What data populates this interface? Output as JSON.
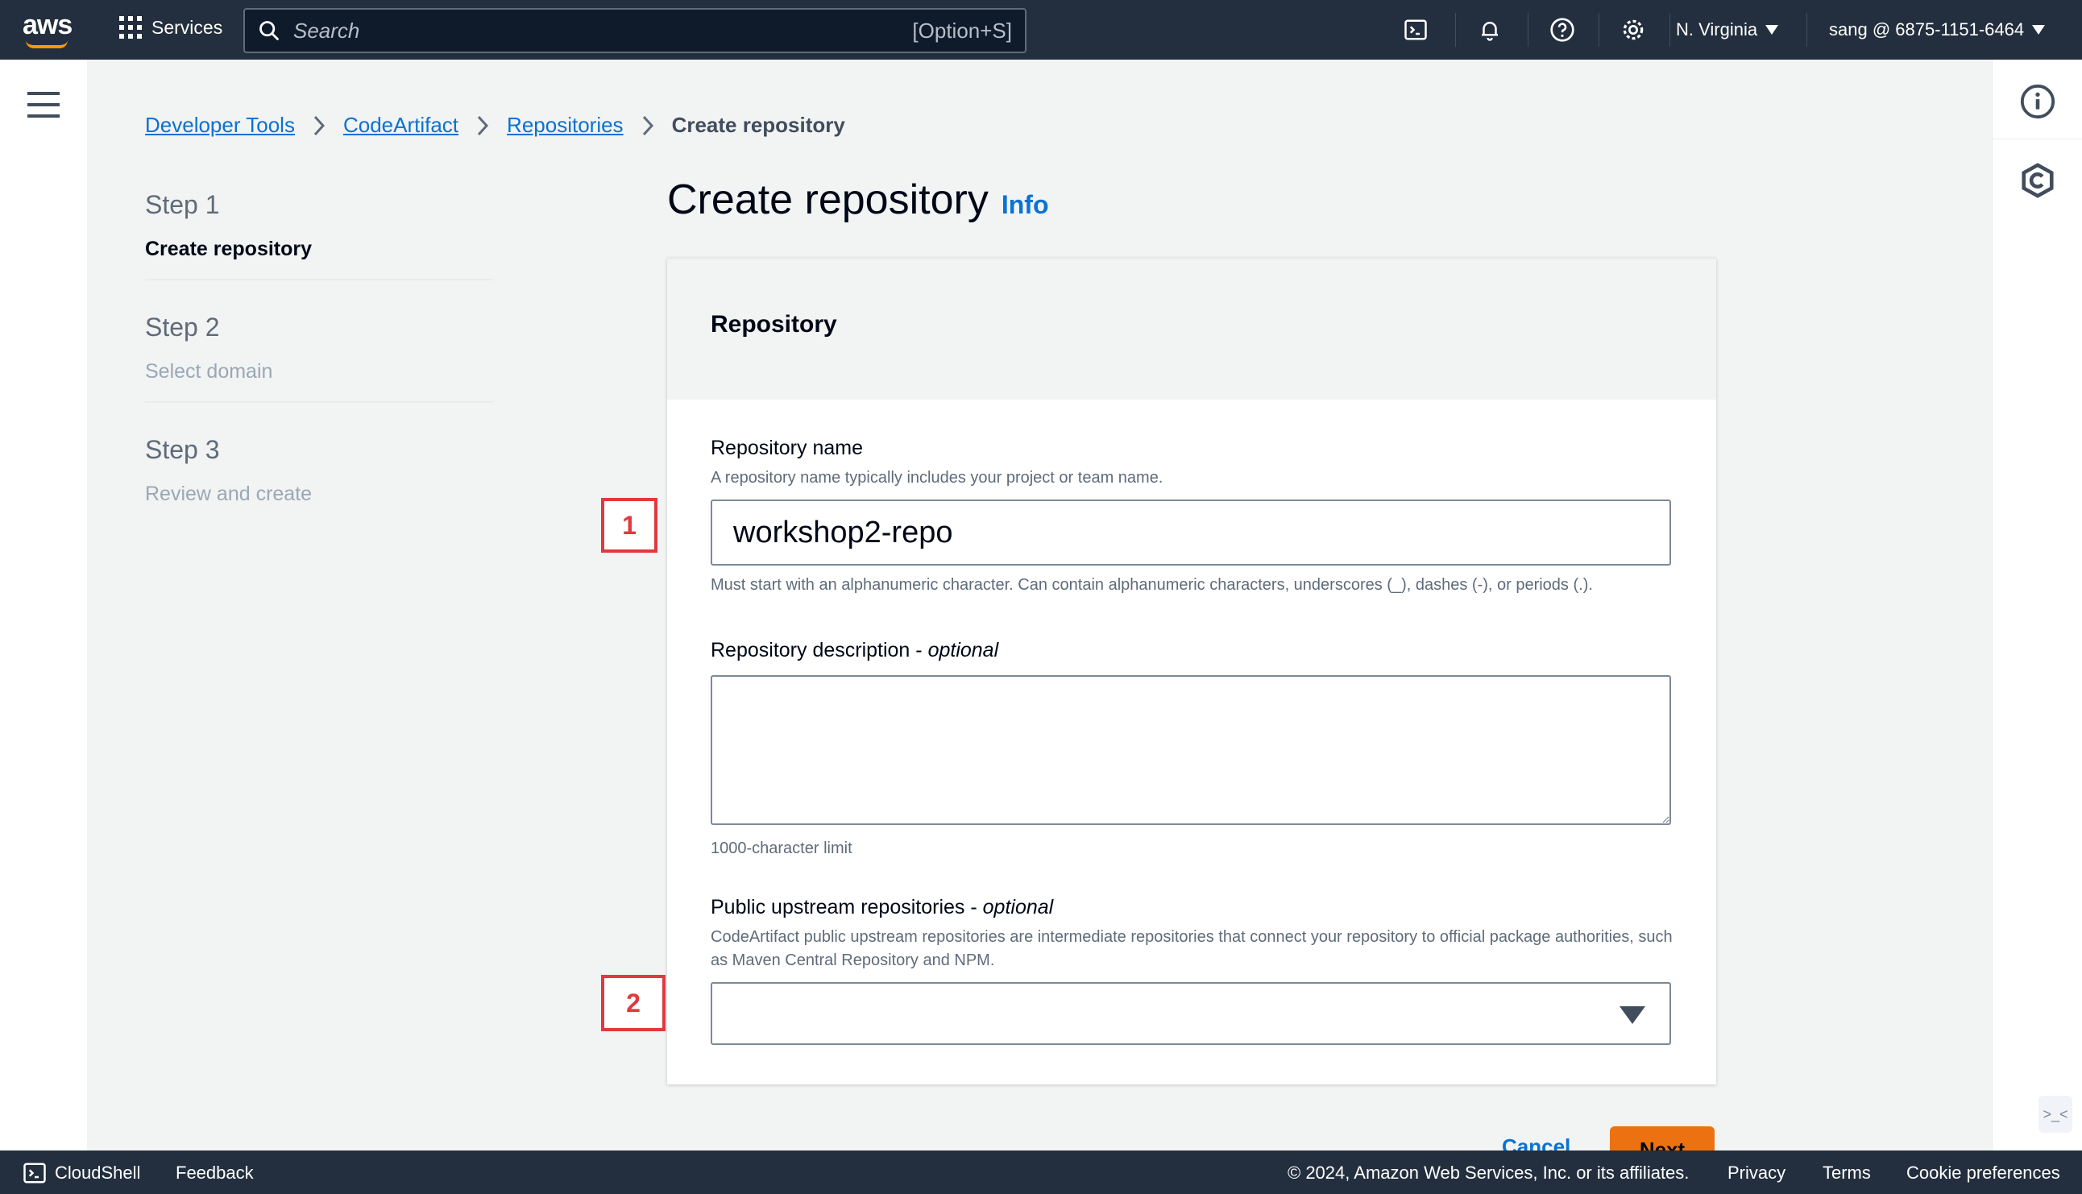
{
  "nav": {
    "logo": "aws",
    "services_label": "Services",
    "search_placeholder": "Search",
    "search_shortcut": "[Option+S]",
    "region": "N. Virginia",
    "account": "sang @ 6875-1151-6464"
  },
  "breadcrumb": {
    "items": [
      "Developer Tools",
      "CodeArtifact",
      "Repositories"
    ],
    "current": "Create repository"
  },
  "steps": [
    {
      "num": "Step 1",
      "title": "Create repository"
    },
    {
      "num": "Step 2",
      "title": "Select domain"
    },
    {
      "num": "Step 3",
      "title": "Review and create"
    }
  ],
  "page": {
    "title": "Create repository",
    "info": "Info"
  },
  "panel": {
    "title": "Repository",
    "name_label": "Repository name",
    "name_desc": "A repository name typically includes your project or team name.",
    "name_value": "workshop2-repo",
    "name_constraint": "Must start with an alphanumeric character. Can contain alphanumeric characters, underscores (_), dashes (-), or periods (.).",
    "desc_label": "Repository description - ",
    "desc_optional": "optional",
    "desc_value": "",
    "desc_limit": "1000-character limit",
    "upstream_label": "Public upstream repositories - ",
    "upstream_optional": "optional",
    "upstream_desc": "CodeArtifact public upstream repositories are intermediate repositories that connect your repository to official package authorities, such as Maven Central Repository and NPM."
  },
  "markers": [
    "1",
    "2"
  ],
  "actions": {
    "cancel": "Cancel",
    "next": "Next"
  },
  "footer": {
    "cloudshell": "CloudShell",
    "feedback": "Feedback",
    "copyright": "© 2024, Amazon Web Services, Inc. or its affiliates.",
    "privacy": "Privacy",
    "terms": "Terms",
    "cookie": "Cookie preferences"
  },
  "icons": {
    "services": "grid-icon",
    "search": "search-icon",
    "cloudshell": "terminal-icon",
    "notifications": "bell-icon",
    "help": "help-icon",
    "settings": "gear-icon",
    "info_panel": "info-icon",
    "extra": "hexagon-icon"
  },
  "colors": {
    "nav_bg": "#232f3e",
    "link": "#0972d3",
    "marker": "#e0393e",
    "primary_button": "#ec7211"
  }
}
